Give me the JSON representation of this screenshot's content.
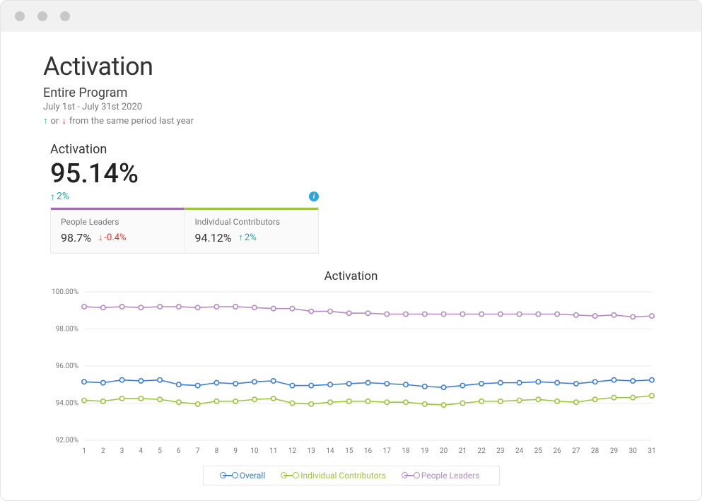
{
  "header": {
    "title": "Activation",
    "subtitle": "Entire Program",
    "date_range": "July 1st - July 31st 2020",
    "legend_or": "or",
    "legend_note_tail": "from the same period last year"
  },
  "metric": {
    "label": "Activation",
    "value": "95.14%",
    "delta": "2%",
    "delta_direction": "up"
  },
  "split": {
    "people_leaders": {
      "label": "People Leaders",
      "value": "98.7%",
      "delta": "-0.4%",
      "direction": "down"
    },
    "individual_contributors": {
      "label": "Individual Contributors",
      "value": "94.12%",
      "delta": "2%",
      "direction": "up"
    }
  },
  "chart_data": {
    "type": "line",
    "title": "Activation",
    "xlabel": "",
    "ylabel": "",
    "ylim": [
      92,
      100
    ],
    "y_ticks": [
      "100.00%",
      "98.00%",
      "96.00%",
      "94.00%",
      "92.00%"
    ],
    "categories": [
      1,
      2,
      3,
      4,
      5,
      6,
      7,
      8,
      9,
      10,
      11,
      12,
      13,
      14,
      15,
      16,
      17,
      18,
      19,
      20,
      21,
      22,
      23,
      24,
      25,
      26,
      27,
      28,
      29,
      30,
      31
    ],
    "series": [
      {
        "name": "Overall",
        "color": "#3b7dd8",
        "values": [
          95.15,
          95.1,
          95.25,
          95.2,
          95.25,
          95.0,
          94.95,
          95.1,
          95.05,
          95.15,
          95.2,
          94.95,
          94.95,
          95.0,
          95.05,
          95.1,
          95.05,
          95.0,
          94.9,
          94.85,
          94.95,
          95.05,
          95.1,
          95.1,
          95.15,
          95.1,
          95.05,
          95.15,
          95.25,
          95.2,
          95.25
        ]
      },
      {
        "name": "Individual Contributors",
        "color": "#9bc53d",
        "values": [
          94.15,
          94.1,
          94.25,
          94.25,
          94.2,
          94.05,
          93.95,
          94.1,
          94.1,
          94.2,
          94.25,
          94.0,
          93.95,
          94.05,
          94.1,
          94.1,
          94.05,
          94.05,
          93.95,
          93.9,
          94.0,
          94.1,
          94.1,
          94.15,
          94.2,
          94.1,
          94.05,
          94.2,
          94.3,
          94.3,
          94.4
        ]
      },
      {
        "name": "People Leaders",
        "color": "#b58ac2",
        "values": [
          99.2,
          99.15,
          99.2,
          99.15,
          99.2,
          99.2,
          99.15,
          99.2,
          99.2,
          99.15,
          99.1,
          99.1,
          98.95,
          98.95,
          98.85,
          98.85,
          98.8,
          98.8,
          98.8,
          98.8,
          98.8,
          98.8,
          98.8,
          98.8,
          98.8,
          98.8,
          98.75,
          98.7,
          98.75,
          98.65,
          98.7
        ]
      }
    ],
    "legend_labels": {
      "overall": "Overall",
      "ic": "Individual Contributors",
      "pl": "People Leaders"
    }
  }
}
